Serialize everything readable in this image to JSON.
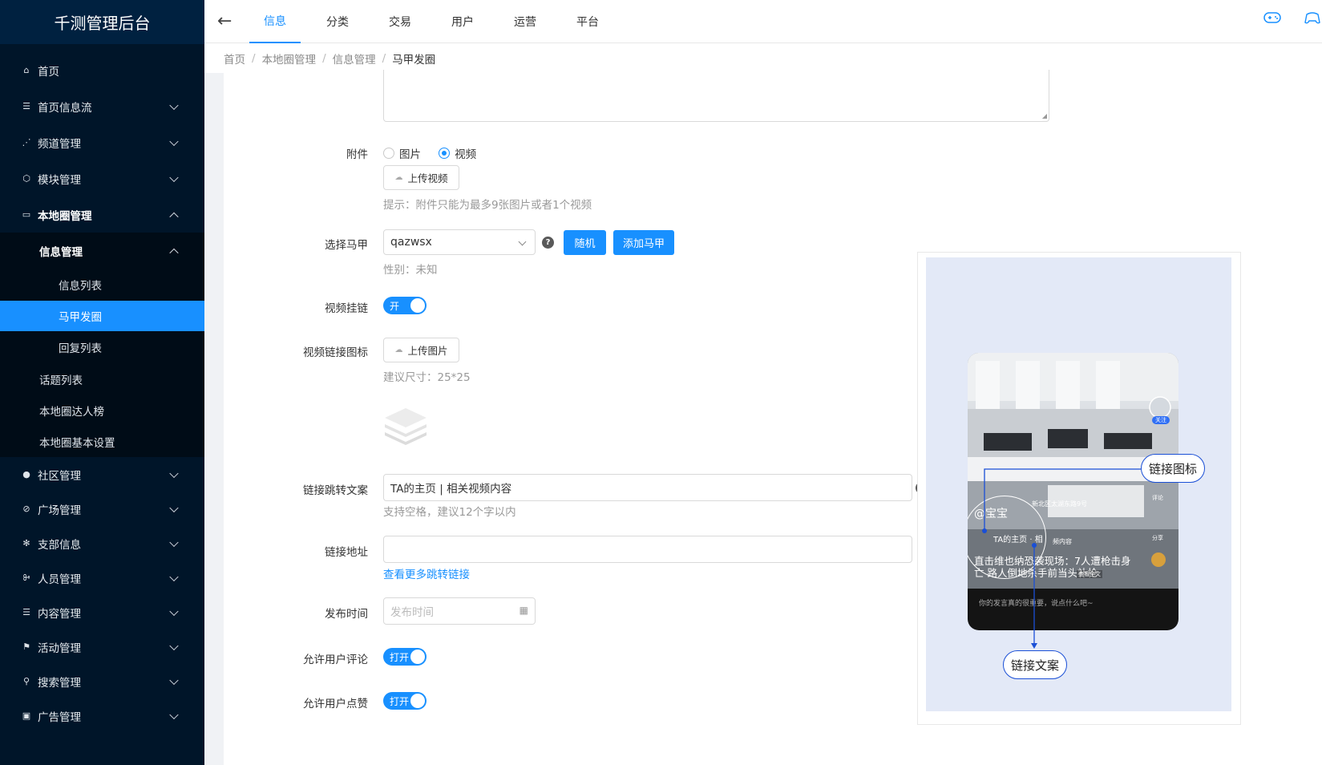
{
  "app": {
    "title": "千测管理后台"
  },
  "sidebar": {
    "items": [
      {
        "label": "首页",
        "icon": "home-icon"
      },
      {
        "label": "首页信息流",
        "icon": "list-icon"
      },
      {
        "label": "频道管理",
        "icon": "rss-icon"
      },
      {
        "label": "模块管理",
        "icon": "cube-icon"
      },
      {
        "label": "本地圈管理",
        "icon": "card-icon"
      }
    ],
    "local_sub": {
      "info_mgmt": "信息管理",
      "info_children": [
        "信息列表",
        "马甲发圈",
        "回复列表"
      ],
      "others": [
        "话题列表",
        "本地圈达人榜",
        "本地圈基本设置"
      ]
    },
    "bottom_items": [
      {
        "label": "社区管理",
        "icon": "user-icon"
      },
      {
        "label": "广场管理",
        "icon": "compass-icon"
      },
      {
        "label": "支部信息",
        "icon": "gear-icon"
      },
      {
        "label": "人员管理",
        "icon": "group-icon"
      },
      {
        "label": "内容管理",
        "icon": "doc-icon"
      },
      {
        "label": "活动管理",
        "icon": "flag-icon"
      },
      {
        "label": "搜索管理",
        "icon": "search-icon"
      },
      {
        "label": "广告管理",
        "icon": "ad-icon"
      }
    ]
  },
  "topnav": {
    "tabs": [
      "信息",
      "分类",
      "交易",
      "用户",
      "运营",
      "平台"
    ]
  },
  "breadcrumb": [
    "首页",
    "本地圈管理",
    "信息管理",
    "马甲发圈"
  ],
  "form": {
    "attachment": {
      "label": "附件",
      "options": [
        "图片",
        "视频"
      ],
      "selected": "视频",
      "upload_label": "上传视频",
      "hint": "提示：附件只能为最多9张图片或者1个视频"
    },
    "vest": {
      "label": "选择马甲",
      "value": "qazwsx",
      "random_label": "随机",
      "add_label": "添加马甲",
      "gender_hint": "性别：未知"
    },
    "video_link": {
      "label": "视频挂链",
      "switch_text": "开"
    },
    "link_icon": {
      "label": "视频链接图标",
      "upload_label": "上传图片",
      "hint": "建议尺寸：25*25"
    },
    "link_text": {
      "label": "链接跳转文案",
      "value": "TA的主页 | 相关视频内容",
      "hint": "支持空格，建议12个字以内"
    },
    "link_url": {
      "label": "链接地址",
      "value": "",
      "more_link": "查看更多跳转链接"
    },
    "publish_time": {
      "label": "发布时间",
      "placeholder": "发布时间"
    },
    "allow_comment": {
      "label": "允许用户评论",
      "switch_text": "打开"
    },
    "allow_like": {
      "label": "允许用户点赞",
      "switch_text": "打开"
    }
  },
  "preview": {
    "callout_icon": "链接图标",
    "callout_text": "链接文案",
    "username": "@宝宝",
    "location": "新北区太湖东路9号",
    "link_line": "TA的主页 · 相",
    "link_line_tail": "频内容",
    "caption": "直击维也纳恐袭现场：7人遭枪击身亡 路人倒地杀手前当头补枪",
    "read_more": "查看全文",
    "comment_placeholder": "你的发言真的很重要，说点什么吧~",
    "follow": "关注",
    "comment": "评论",
    "share": "分享"
  },
  "colors": {
    "primary": "#1890ff",
    "sidebar": "#001529",
    "callout": "#1a4fd6"
  }
}
